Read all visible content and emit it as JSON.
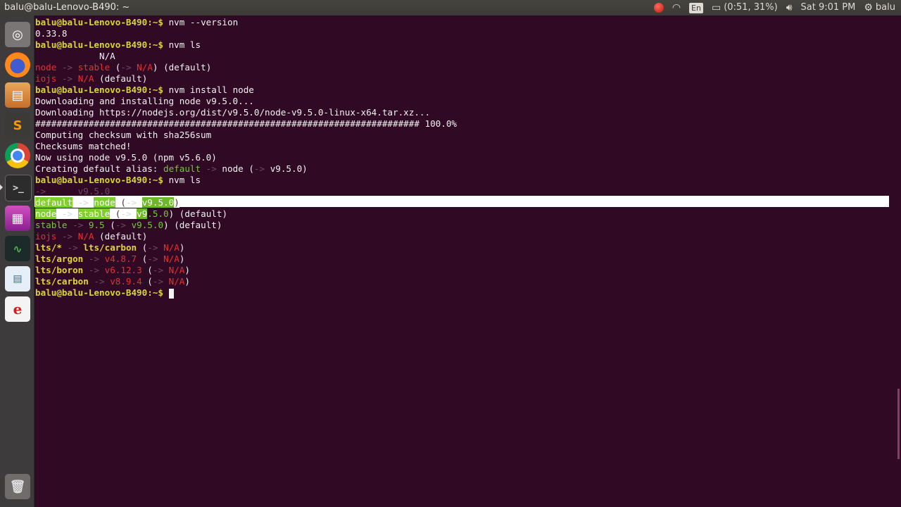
{
  "topbar": {
    "window_title": "balu@balu-Lenovo-B490: ~",
    "language": "En",
    "battery": "(0:51, 31%)",
    "clock": "Sat 9:01 PM",
    "user": "balu"
  },
  "launcher": {
    "items": [
      {
        "name": "ubuntu-home",
        "glyph": "◎"
      },
      {
        "name": "firefox",
        "glyph": ""
      },
      {
        "name": "files",
        "glyph": "▤"
      },
      {
        "name": "sublime-text",
        "glyph": "S"
      },
      {
        "name": "chrome",
        "glyph": ""
      },
      {
        "name": "terminal",
        "glyph": ">_"
      },
      {
        "name": "software-center",
        "glyph": "▦"
      },
      {
        "name": "system-monitor",
        "glyph": "∿"
      },
      {
        "name": "libreoffice-writer",
        "glyph": "▤"
      },
      {
        "name": "text-editor",
        "glyph": "e"
      },
      {
        "name": "trash",
        "glyph": "🗑"
      }
    ]
  },
  "terminal": {
    "prompt": "balu@balu-Lenovo-B490:~$",
    "cmd1": "nvm --version",
    "out_version": "0.33.8",
    "cmd2": "nvm ls",
    "out_na": "            N/A",
    "cmd3": "nvm install node",
    "dl1": "Downloading and installing node v9.5.0...",
    "dl2": "Downloading https://nodejs.org/dist/v9.5.0/node-v9.5.0-linux-x64.tar.xz...",
    "progress_bar": "######################################################################## 100.0%",
    "checksum1": "Computing checksum with sha256sum",
    "checksum2": "Checksums matched!",
    "now_using": "Now using node v9.5.0 (npm v5.6.0)",
    "alias_prefix": "Creating default alias: ",
    "cmd4": "nvm ls",
    "current_version": "v9.5.0"
  },
  "colors": {
    "terminal_bg": "#300a24",
    "prompt": "#d8d634",
    "red": "#e63030",
    "green": "#73c73a",
    "selection": "#ffffff"
  }
}
